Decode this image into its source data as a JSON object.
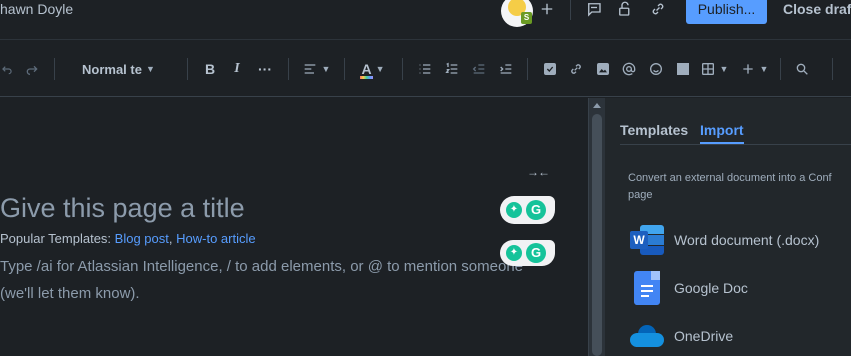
{
  "header": {
    "user_name": "hawn Doyle",
    "publish_label": "Publish...",
    "close_draft_label": "Close draft",
    "avatar_badge": "S"
  },
  "toolbar": {
    "text_style": "Normal te",
    "bold": "B",
    "italic": "I",
    "more": "···",
    "color_letter": "A"
  },
  "editor": {
    "title_placeholder": "Give this page a title",
    "popular_label": "Popular Templates:",
    "template_links": [
      "Blog post",
      "How-to article"
    ],
    "link_separator": ",",
    "body_placeholder": "Type /ai for Atlassian Intelligence, / to add elements, or @ to mention someone (we'll let them know)."
  },
  "side_panel": {
    "tabs": [
      {
        "label": "Templates",
        "active": false
      },
      {
        "label": "Import",
        "active": true
      }
    ],
    "convert_line1": "Convert an external document into a Conf",
    "convert_line2": "page",
    "import_options": [
      {
        "label": "Word document (.docx)",
        "icon": "word-icon"
      },
      {
        "label": "Google Doc",
        "icon": "google-doc-icon"
      },
      {
        "label": "OneDrive",
        "icon": "onedrive-icon"
      }
    ]
  },
  "colors": {
    "background": "#1d2125",
    "panel": "#22272b",
    "accent": "#579dff",
    "grammarly": "#15c39a"
  }
}
